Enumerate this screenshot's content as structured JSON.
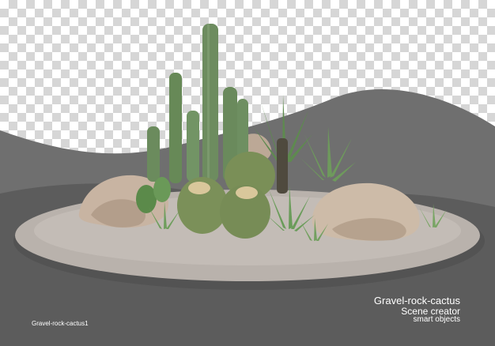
{
  "preview": {
    "title": "Gravel-rock-cactus",
    "subtitle": "Scene creator",
    "tagline": "smart objects",
    "file_label": "Gravel-rock-cactus1"
  },
  "colors": {
    "dark_wave": "#5f5f5f",
    "mid_wave": "#7a7a7a",
    "gravel": "#b7b1ab",
    "rock": "#c9b8a8",
    "cactus": "#6f8f62",
    "barrel": "#7b8f5a"
  },
  "icons": {
    "scene": "gravel-rock-cactus-scene"
  }
}
